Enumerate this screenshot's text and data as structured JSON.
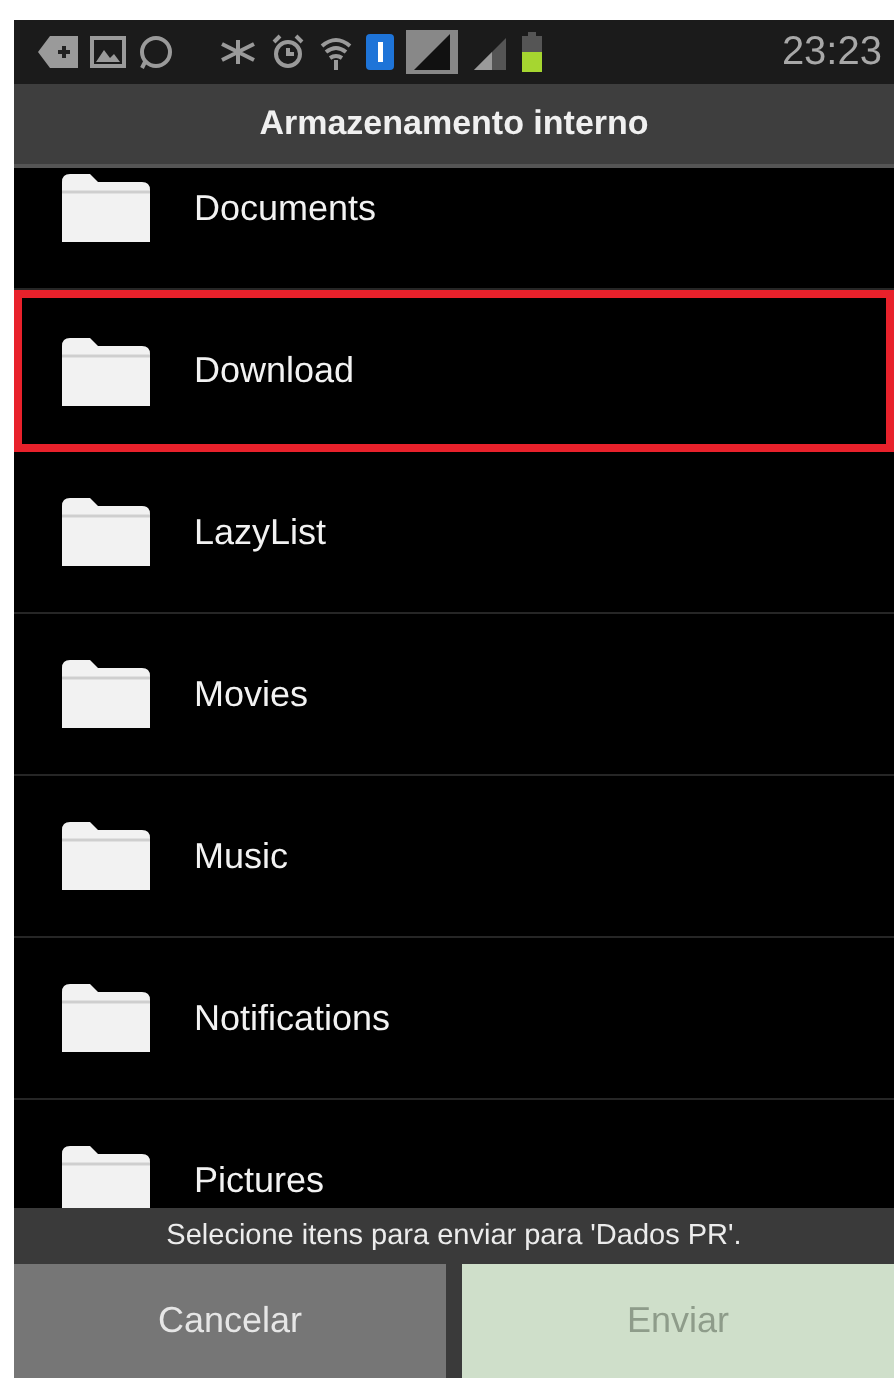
{
  "status_bar": {
    "time": "23:23"
  },
  "title": "Armazenamento interno",
  "folders": [
    {
      "name": "Documents",
      "highlighted": false
    },
    {
      "name": "Download",
      "highlighted": true
    },
    {
      "name": "LazyList",
      "highlighted": false
    },
    {
      "name": "Movies",
      "highlighted": false
    },
    {
      "name": "Music",
      "highlighted": false
    },
    {
      "name": "Notifications",
      "highlighted": false
    },
    {
      "name": "Pictures",
      "highlighted": false
    }
  ],
  "message": "Selecione itens para enviar para 'Dados PR'.",
  "buttons": [
    {
      "label": "Cancelar",
      "disabled": false
    },
    {
      "label": "Enviar",
      "disabled": true
    }
  ]
}
